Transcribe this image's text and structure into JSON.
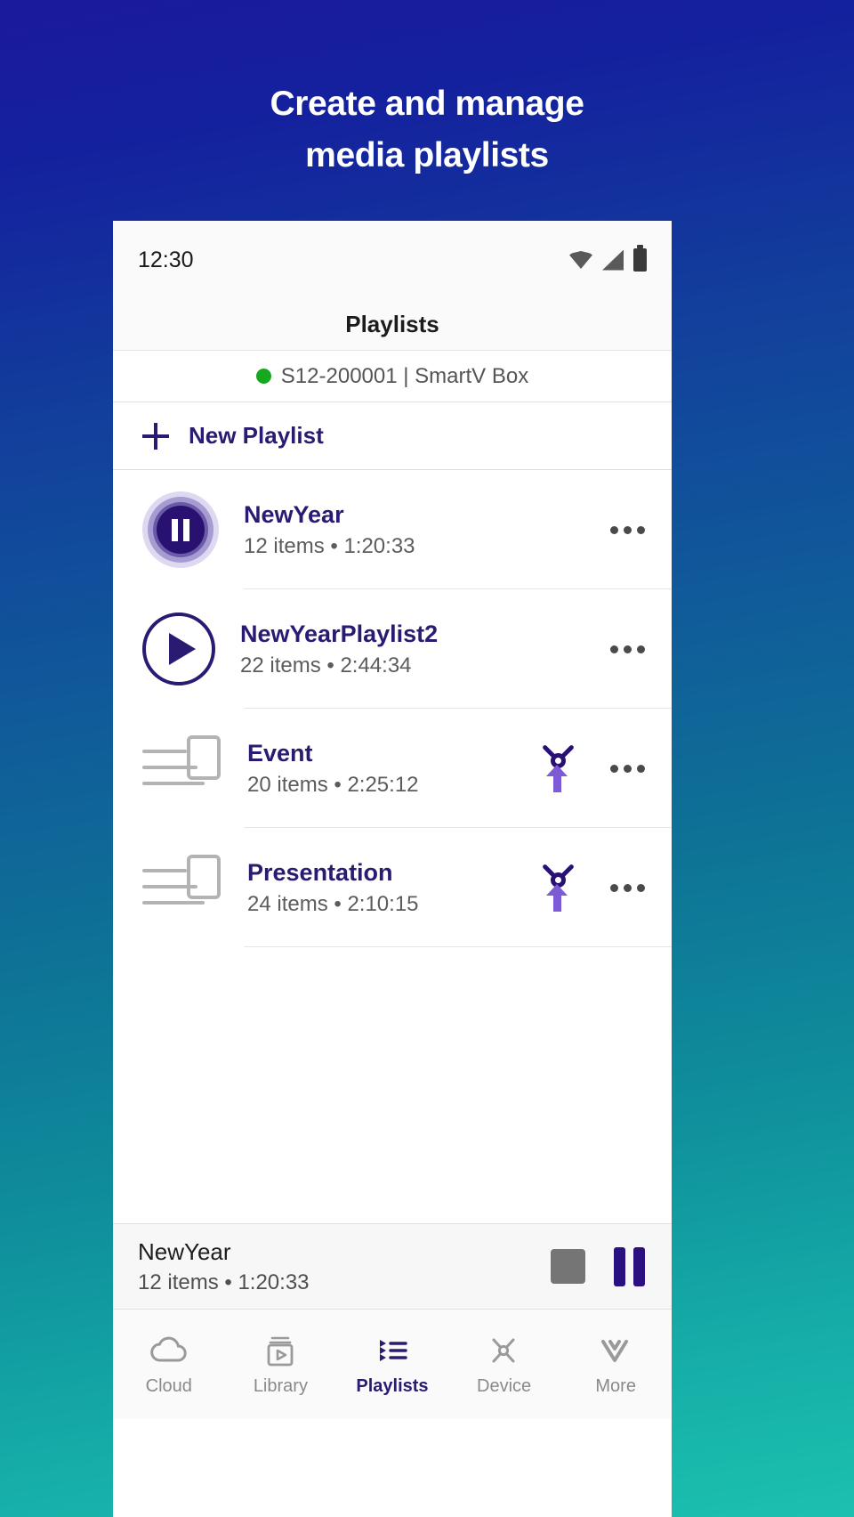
{
  "headline": {
    "line1": "Create and manage",
    "line2": "media playlists"
  },
  "status_bar": {
    "time": "12:30",
    "icons": [
      "wifi-icon",
      "signal-icon",
      "battery-icon"
    ]
  },
  "app_bar": {
    "title": "Playlists"
  },
  "device_bar": {
    "status_color": "#16a81f",
    "name": "S12-200001 | SmartV Box"
  },
  "new_playlist": {
    "label": "New Playlist",
    "icon": "plus-icon"
  },
  "playlists": [
    {
      "title": "NewYear",
      "meta": "12 items • 1:20:33",
      "art": "pause-playing",
      "has_push": false,
      "overflow": "overflow-menu-icon"
    },
    {
      "title": "NewYearPlaylist2",
      "meta": "22 items • 2:44:34",
      "art": "play-circle",
      "has_push": false,
      "overflow": "overflow-menu-icon"
    },
    {
      "title": "Event",
      "meta": "20 items • 2:25:12",
      "art": "device-playlist",
      "has_push": true,
      "overflow": "overflow-menu-icon"
    },
    {
      "title": "Presentation",
      "meta": "24 items • 2:10:15",
      "art": "device-playlist",
      "has_push": true,
      "overflow": "overflow-menu-icon"
    }
  ],
  "now_playing": {
    "title": "NewYear",
    "meta": "12 items • 1:20:33",
    "stop_label": "stop-button",
    "pause_label": "pause-button"
  },
  "tabs": [
    {
      "label": "Cloud",
      "icon": "cloud-icon",
      "active": false
    },
    {
      "label": "Library",
      "icon": "library-icon",
      "active": false
    },
    {
      "label": "Playlists",
      "icon": "playlist-icon",
      "active": true
    },
    {
      "label": "Device",
      "icon": "device-icon",
      "active": false
    },
    {
      "label": "More",
      "icon": "chevron-double-down-icon",
      "active": false
    }
  ],
  "colors": {
    "brand_navy": "#2a1a72",
    "accent_purple": "#7e5bd6",
    "online_green": "#16a81f",
    "bg_top": "#1a1a9c",
    "bg_bottom": "#1cc0b0"
  }
}
